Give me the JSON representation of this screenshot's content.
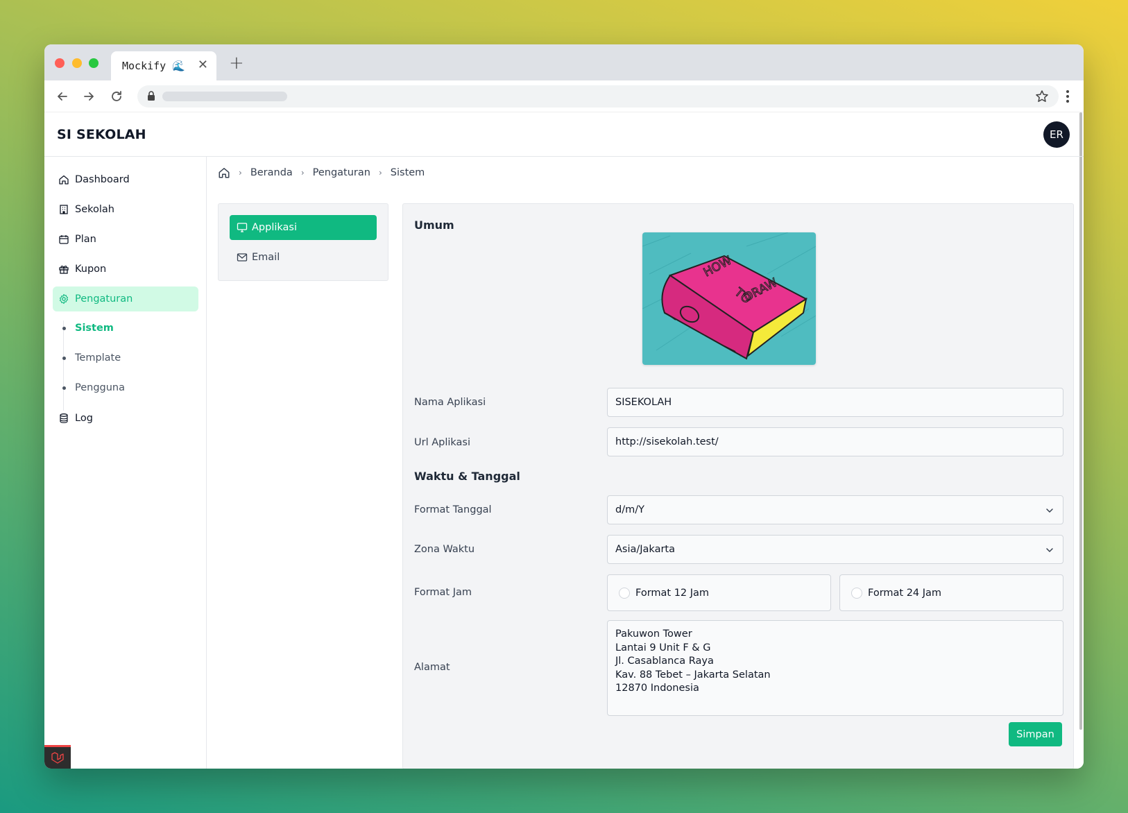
{
  "browser": {
    "tab_title": "Mockify 🌊",
    "tab_close": "✕",
    "new_tab": "+"
  },
  "header": {
    "brand": "SI SEKOLAH",
    "avatar_initials": "ER"
  },
  "sidebar": {
    "items": [
      {
        "label": "Dashboard",
        "icon": "home-icon"
      },
      {
        "label": "Sekolah",
        "icon": "building-icon"
      },
      {
        "label": "Plan",
        "icon": "calendar-icon"
      },
      {
        "label": "Kupon",
        "icon": "gift-icon"
      },
      {
        "label": "Pengaturan",
        "icon": "gear-icon"
      },
      {
        "label": "Log",
        "icon": "database-icon"
      }
    ],
    "subitems": [
      {
        "label": "Sistem"
      },
      {
        "label": "Template"
      },
      {
        "label": "Pengguna"
      }
    ]
  },
  "breadcrumb": {
    "items": [
      "Beranda",
      "Pengaturan",
      "Sistem"
    ]
  },
  "settings_menu": {
    "items": [
      {
        "label": "Applikasi",
        "icon": "monitor-icon"
      },
      {
        "label": "Email",
        "icon": "mail-icon"
      }
    ]
  },
  "form": {
    "section_general": "Umum",
    "section_datetime": "Waktu & Tanggal",
    "app_name_label": "Nama Aplikasi",
    "app_name_value": "SISEKOLAH",
    "app_url_label": "Url Aplikasi",
    "app_url_value": "http://sisekolah.test/",
    "date_format_label": "Format Tanggal",
    "date_format_value": "d/m/Y",
    "timezone_label": "Zona Waktu",
    "timezone_value": "Asia/Jakarta",
    "time_format_label": "Format Jam",
    "time_format_12": "Format 12 Jam",
    "time_format_24": "Format 24 Jam",
    "address_label": "Alamat",
    "address_value": "Pakuwon Tower\nLantai 9 Unit F & G\nJl. Casablanca Raya\nKav. 88 Tebet – Jakarta Selatan\n12870 Indonesia",
    "save_label": "Simpan"
  },
  "colors": {
    "accent": "#10b981",
    "accent_light": "#d1fae5"
  }
}
